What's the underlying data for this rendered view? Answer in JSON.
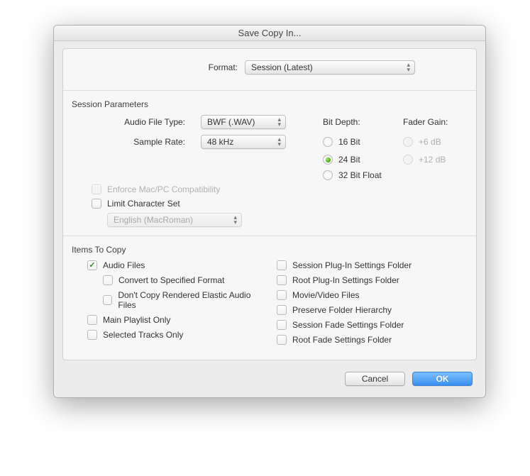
{
  "window": {
    "title": "Save Copy In..."
  },
  "format": {
    "label": "Format:",
    "value": "Session (Latest)"
  },
  "session_parameters": {
    "title": "Session Parameters",
    "audio_file_type": {
      "label": "Audio File Type:",
      "value": "BWF (.WAV)"
    },
    "sample_rate": {
      "label": "Sample Rate:",
      "value": "48 kHz"
    },
    "bit_depth": {
      "label": "Bit Depth:",
      "options": [
        "16 Bit",
        "24 Bit",
        "32 Bit Float"
      ],
      "selected": "24 Bit"
    },
    "fader_gain": {
      "label": "Fader Gain:",
      "options": [
        "+6 dB",
        "+12 dB"
      ],
      "selected": null,
      "enabled": false
    },
    "enforce_compat": {
      "label": "Enforce Mac/PC Compatibility",
      "checked": false,
      "enabled": false
    },
    "limit_charset": {
      "label": "Limit Character Set",
      "checked": false,
      "enabled": true
    },
    "charset_select": {
      "value": "English (MacRoman)",
      "enabled": false
    }
  },
  "items_to_copy": {
    "title": "Items To Copy",
    "left": [
      {
        "id": "audio-files",
        "label": "Audio Files",
        "checked": true,
        "nested": false
      },
      {
        "id": "convert-format",
        "label": "Convert to Specified Format",
        "checked": false,
        "nested": true
      },
      {
        "id": "dont-copy-elastic",
        "label": "Don't Copy Rendered Elastic Audio Files",
        "checked": false,
        "nested": true
      },
      {
        "id": "main-playlist",
        "label": "Main Playlist Only",
        "checked": false,
        "nested": false
      },
      {
        "id": "selected-tracks",
        "label": "Selected Tracks Only",
        "checked": false,
        "nested": false
      }
    ],
    "right": [
      {
        "id": "session-plugin",
        "label": "Session Plug-In Settings Folder",
        "checked": false
      },
      {
        "id": "root-plugin",
        "label": "Root Plug-In Settings Folder",
        "checked": false
      },
      {
        "id": "movie-video",
        "label": "Movie/Video Files",
        "checked": false
      },
      {
        "id": "preserve-hierarchy",
        "label": "Preserve Folder Hierarchy",
        "checked": false
      },
      {
        "id": "session-fade",
        "label": "Session Fade Settings Folder",
        "checked": false
      },
      {
        "id": "root-fade",
        "label": "Root Fade Settings Folder",
        "checked": false
      }
    ]
  },
  "buttons": {
    "cancel": "Cancel",
    "ok": "OK"
  }
}
